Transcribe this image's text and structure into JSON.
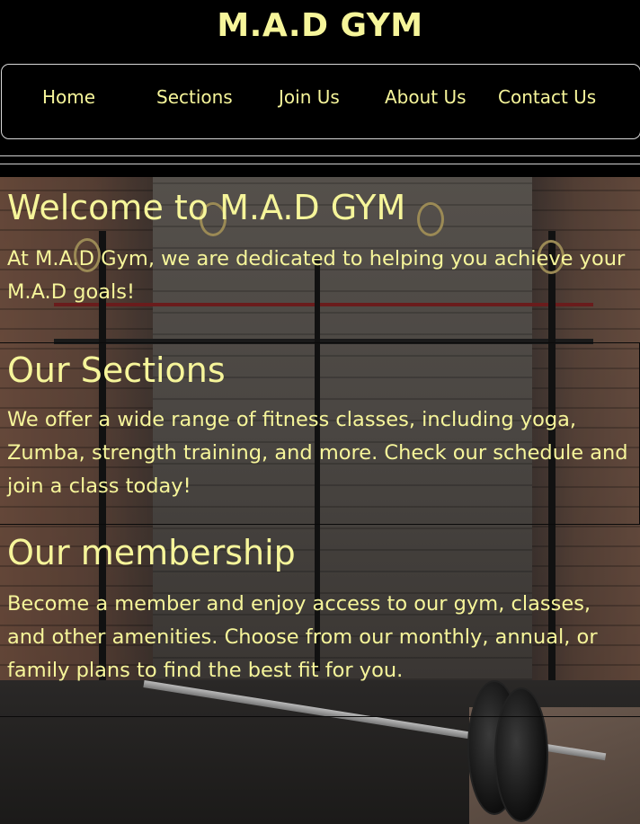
{
  "header": {
    "title": "M.A.D GYM"
  },
  "nav": {
    "items": [
      {
        "label": "Home"
      },
      {
        "label": "Sections"
      },
      {
        "label": "Join Us"
      },
      {
        "label": "About Us"
      },
      {
        "label": "Contact Us"
      }
    ]
  },
  "colors": {
    "accent": "#f6f59a",
    "background": "#000000"
  },
  "sections": [
    {
      "title": "Welcome to M.A.D GYM",
      "text": "At M.A.D Gym, we are dedicated to helping you achieve your M.A.D goals!"
    },
    {
      "title": "Our Sections",
      "text": "We offer a wide range of fitness classes, including yoga, Zumba, strength training, and more. Check our schedule and join a class today!"
    },
    {
      "title": "Our membership",
      "text": "Become a member and enjoy access to our gym, classes, and other amenities. Choose from our monthly, annual, or family plans to find the best fit for you."
    }
  ]
}
